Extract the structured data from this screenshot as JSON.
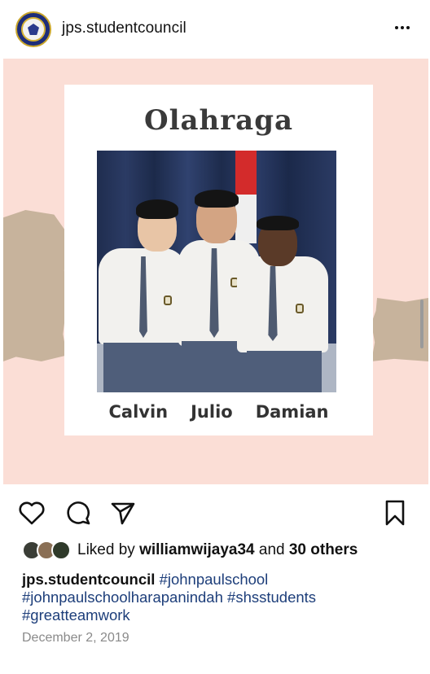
{
  "header": {
    "username": "jps.studentcouncil",
    "more_icon": "more-horizontal-icon"
  },
  "post": {
    "title": "Olahraga",
    "names": [
      "Calvin",
      "Julio",
      "Damian"
    ]
  },
  "actions": {
    "like_icon": "heart-icon",
    "comment_icon": "comment-icon",
    "share_icon": "send-icon",
    "save_icon": "bookmark-icon"
  },
  "likes": {
    "prefix": "Liked by",
    "user": "williamwijaya34",
    "conj": "and",
    "others": "30 others"
  },
  "caption": {
    "username": "jps.studentcouncil",
    "hashtags": [
      "#johnpaulschool",
      "#johnpaulschoolharapanindah",
      "#shsstudents",
      "#greatteamwork"
    ]
  },
  "date": "December 2, 2019",
  "colors": {
    "background_pink": "#fbded6",
    "hashtag": "#1d3e7a"
  }
}
